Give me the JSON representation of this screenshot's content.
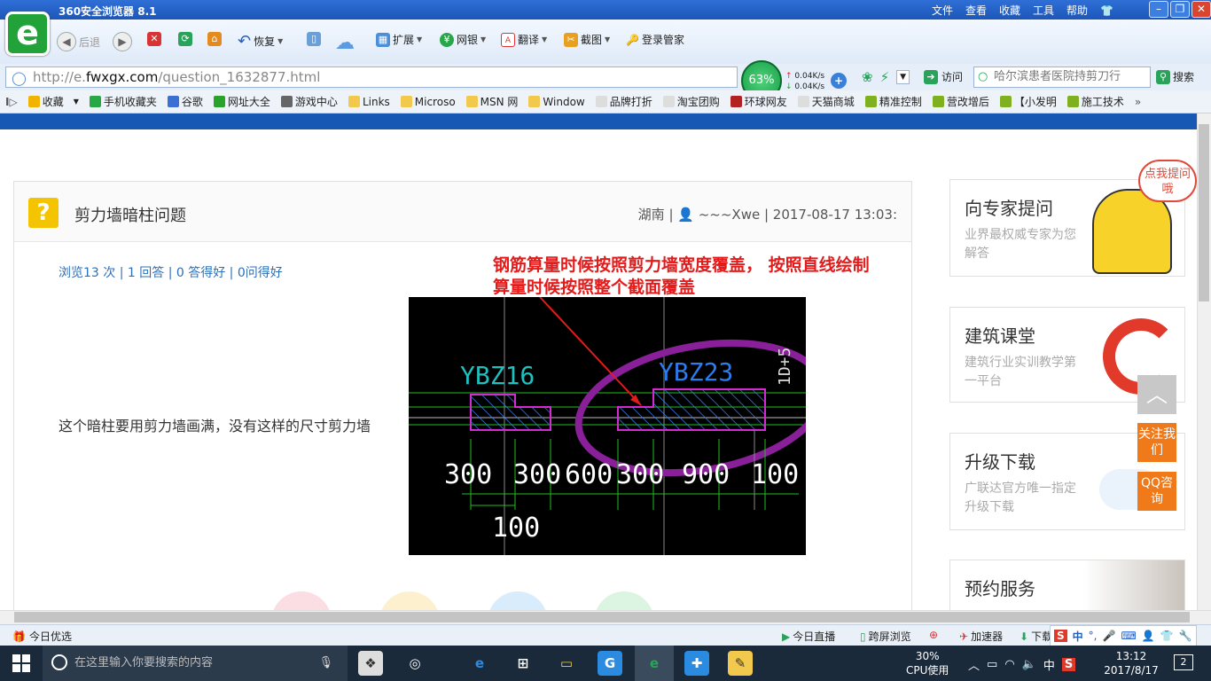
{
  "window": {
    "title": "360安全浏览器 8.1",
    "menu": [
      "文件",
      "查看",
      "收藏",
      "工具",
      "帮助"
    ],
    "logo_letter": "e"
  },
  "toolbar": {
    "back": "后退",
    "restore": "恢复",
    "extend": "扩展",
    "bank": "网银",
    "translate": "翻译",
    "screenshot": "截图",
    "login": "登录管家"
  },
  "address": {
    "prefix": "http://e.",
    "domain": "fwxgx.com",
    "path": "/question_1632877.html",
    "speed_percent": "63%",
    "up_rate": "0.04K/s",
    "down_rate": "0.04K/s",
    "go": "访问",
    "search_text": "哈尔滨患者医院持剪刀行",
    "search_btn": "搜索"
  },
  "bookmarks": [
    {
      "label": "收藏",
      "color": "#f0b400"
    },
    {
      "label": "手机收藏夹",
      "color": "#27a844"
    },
    {
      "label": "谷歌",
      "color": "#3b6fd4"
    },
    {
      "label": "网址大全",
      "color": "#2aa32a"
    },
    {
      "label": "游戏中心",
      "color": "#666666"
    },
    {
      "label": "Links",
      "color": "#f2c94c"
    },
    {
      "label": "Microso",
      "color": "#f2c94c"
    },
    {
      "label": "MSN 网",
      "color": "#f2c94c"
    },
    {
      "label": "Window",
      "color": "#f2c94c"
    },
    {
      "label": "品牌打折",
      "color": "#dddddd"
    },
    {
      "label": "淘宝团购",
      "color": "#dddddd"
    },
    {
      "label": "环球网友",
      "color": "#b22222"
    },
    {
      "label": "天猫商城",
      "color": "#dddddd"
    },
    {
      "label": "精准控制",
      "color": "#7fb020"
    },
    {
      "label": "营改增后",
      "color": "#7fb020"
    },
    {
      "label": "【小发明",
      "color": "#7fb020"
    },
    {
      "label": "施工技术",
      "color": "#7fb020"
    }
  ],
  "question": {
    "icon": "?",
    "title": "剪力墙暗柱问题",
    "meta": "湖南 | 👤 ~~~Xwe | 2017-08-17 13:03:",
    "stats": "浏览13 次 | 1 回答 | 0 答得好 | 0问得好",
    "text": "这个暗柱要用剪力墙画满，没有这样的尺寸剪力墙",
    "annotation_line1": "钢筋算量时候按照剪力墙宽度覆盖， 按照直线绘制",
    "annotation_line2": "算量时候按照整个截面覆盖"
  },
  "cad": {
    "label_left": "YBZ16",
    "label_right": "YBZ23",
    "dims": [
      "300",
      "300",
      "600",
      "300",
      "900",
      "100"
    ],
    "dim_bottom": "100",
    "side_text": "1D+5"
  },
  "sidebar": {
    "ask": {
      "title": "向专家提问",
      "desc": "业界最权威专家为您解答",
      "bubble": "点我提问哦"
    },
    "class": {
      "title": "建筑课堂",
      "desc": "建筑行业实训教学第一平台"
    },
    "upgrade": {
      "title": "升级下载",
      "desc": "广联达官方唯一指定升级下载"
    },
    "booking": {
      "title": "预约服务"
    },
    "follow": "关注我们",
    "qq": "QQ咨询",
    "totop": "︿"
  },
  "statusbar": {
    "left": "今日优选",
    "live": "今日直播",
    "cross": "跨屏浏览",
    "speedup": "加速器",
    "download": "下载",
    "ime": "中"
  },
  "taskbar": {
    "search_placeholder": "在这里输入你要搜索的内容",
    "cpu_percent": "30%",
    "cpu_label": "CPU使用",
    "ime": "中",
    "time": "13:12",
    "date": "2017/8/17",
    "notif_count": "2"
  },
  "colors": {
    "brand_blue": "#1758b5",
    "link_blue": "#2f6fb7",
    "annotation_red": "#e41b1b",
    "accent_orange": "#f07a1a",
    "question_yellow": "#f5c400"
  }
}
